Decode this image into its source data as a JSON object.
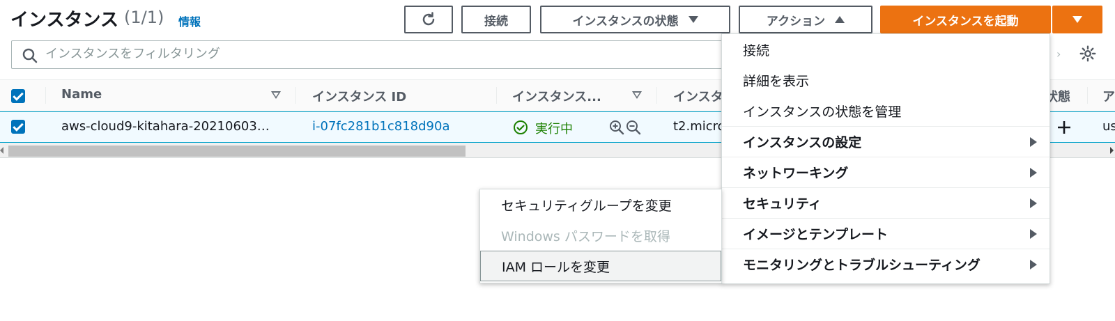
{
  "header": {
    "title": "インスタンス",
    "count": "(1/1)",
    "info_link": "情報"
  },
  "toolbar": {
    "connect_label": "接続",
    "instance_state_label": "インスタンスの状態",
    "actions_label": "アクション",
    "launch_label": "インスタンスを起動"
  },
  "filter": {
    "placeholder": "インスタンスをフィルタリング"
  },
  "table": {
    "columns": [
      "Name",
      "インスタンス ID",
      "インスタンス...",
      "インスタ",
      "状態",
      "ア"
    ],
    "row": {
      "name": "aws-cloud9-kitahara-20210603…",
      "instance_id": "i-07fc281b1c818d90a",
      "state": "実行中",
      "type": "t2.micro",
      "last": "us"
    }
  },
  "actions_menu": {
    "items": [
      "接続",
      "詳細を表示",
      "インスタンスの状態を管理",
      "インスタンスの設定",
      "ネットワーキング",
      "セキュリティ",
      "イメージとテンプレート",
      "モニタリングとトラブルシューティング"
    ]
  },
  "security_submenu": {
    "items": [
      "セキュリティグループを変更",
      "Windows パスワードを取得",
      "IAM ロールを変更"
    ]
  },
  "colors": {
    "primary": "#ec7211",
    "link": "#0073bb",
    "running": "#1d8102"
  }
}
